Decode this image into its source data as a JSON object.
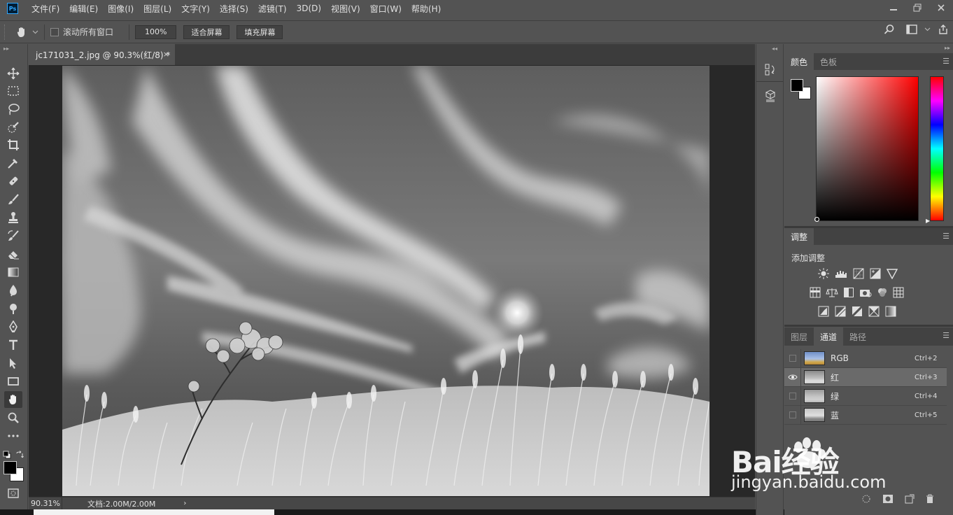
{
  "menu": {
    "app_icon": "Ps",
    "items": [
      "文件(F)",
      "编辑(E)",
      "图像(I)",
      "图层(L)",
      "文字(Y)",
      "选择(S)",
      "滤镜(T)",
      "3D(D)",
      "视图(V)",
      "窗口(W)",
      "帮助(H)"
    ],
    "window_controls": [
      "minimize-icon",
      "restore-icon",
      "close-icon"
    ]
  },
  "options_bar": {
    "scroll_all_label": "滚动所有窗口",
    "zoom_value": "100%",
    "fit_screen_label": "适合屏幕",
    "fill_screen_label": "填充屏幕"
  },
  "document": {
    "tab_title": "jc171031_2.jpg @ 90.3%(红/8) *",
    "tab_close": "×",
    "zoom_readout": "90.31%",
    "doc_info": "文档:2.00M/2.00M",
    "status_arrow": "›"
  },
  "panels": {
    "color_tabs": [
      "颜色",
      "色板"
    ],
    "adjust_tab": "调整",
    "adjust_heading": "添加调整",
    "layer_tabs": [
      "图层",
      "通道",
      "路径"
    ],
    "channels": [
      {
        "name": "RGB",
        "shortcut": "Ctrl+2",
        "visible": false
      },
      {
        "name": "红",
        "shortcut": "Ctrl+3",
        "visible": true
      },
      {
        "name": "绿",
        "shortcut": "Ctrl+4",
        "visible": false
      },
      {
        "name": "蓝",
        "shortcut": "Ctrl+5",
        "visible": false
      }
    ]
  },
  "watermark": {
    "brand": "Bai经验",
    "url": "jingyan.baidu.com"
  },
  "colors": {
    "ui_bg": "#535353",
    "canvas_bg": "#282828",
    "foreground": "#000000",
    "background": "#ffffff"
  }
}
